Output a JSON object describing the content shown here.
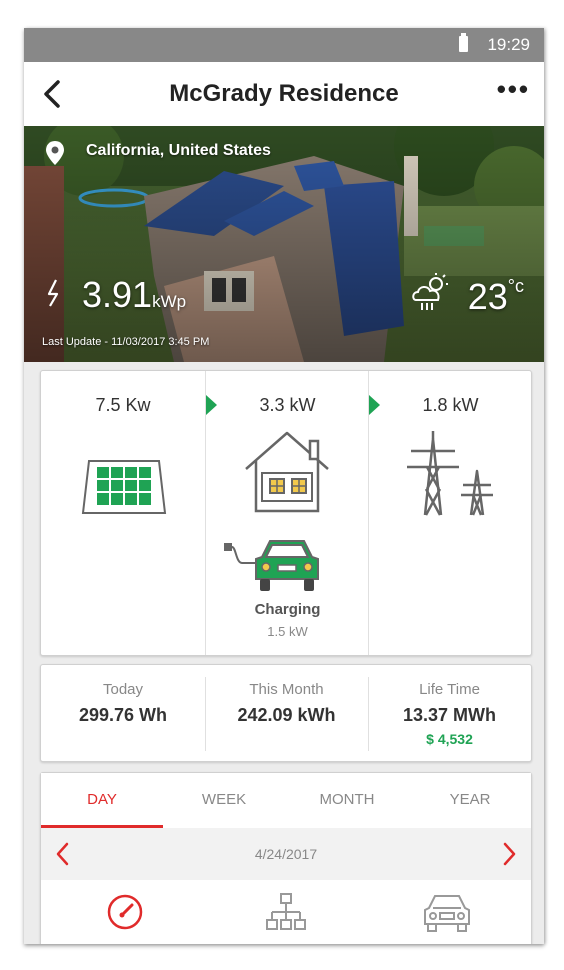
{
  "status": {
    "time": "19:29"
  },
  "header": {
    "title": "McGrady Residence",
    "more_label": "•••"
  },
  "hero": {
    "location": "California, United States",
    "power_value": "3.91",
    "power_unit": "kWp",
    "temp_value": "23",
    "temp_unit": "°c",
    "last_update": "Last Update - 11/03/2017  3:45 PM"
  },
  "flow": {
    "solar_kw": "7.5 Kw",
    "home_kw": "3.3 kW",
    "grid_kw": "1.8 kW",
    "ev_status": "Charging",
    "ev_kw": "1.5 kW",
    "colors": {
      "green": "#1fa354",
      "icon_gray": "#666666"
    }
  },
  "stats": [
    {
      "label": "Today",
      "value": "299.76 Wh"
    },
    {
      "label": "This Month",
      "value": "242.09 kWh"
    },
    {
      "label": "Life Time",
      "value": "13.37 MWh",
      "money": "$ 4,532"
    }
  ],
  "tabs": [
    {
      "label": "DAY",
      "active": true
    },
    {
      "label": "WEEK",
      "active": false
    },
    {
      "label": "MONTH",
      "active": false
    },
    {
      "label": "YEAR",
      "active": false
    }
  ],
  "date": "4/24/2017",
  "bottom_icons": [
    "gauge-icon",
    "network-icon",
    "car-icon"
  ],
  "accent_color": "#e02b2b"
}
